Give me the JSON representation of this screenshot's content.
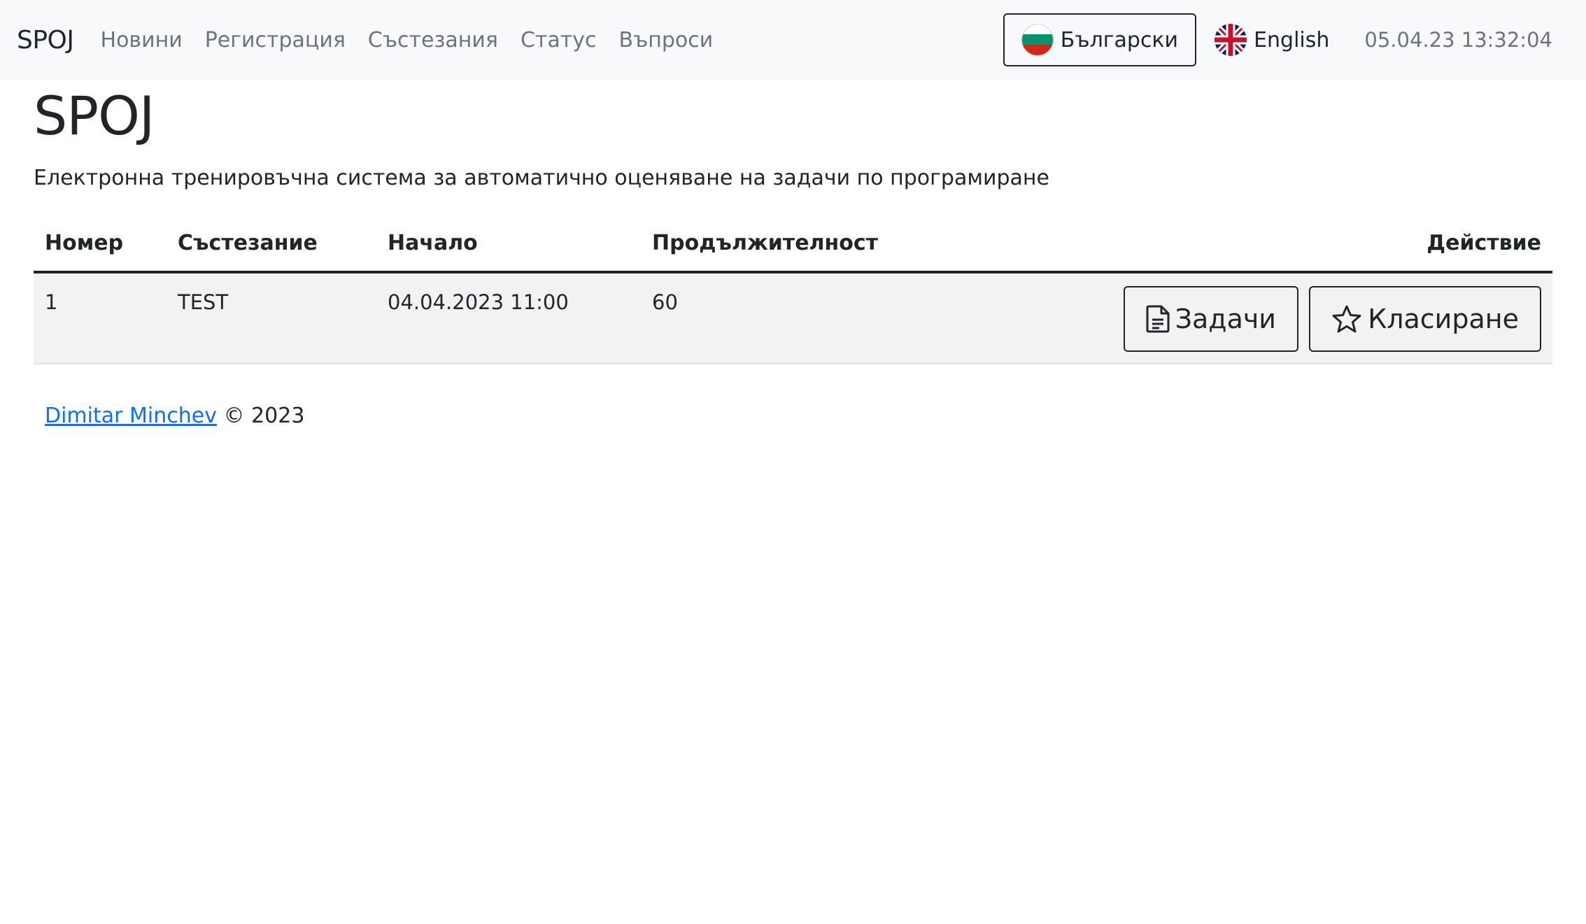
{
  "navbar": {
    "brand": "SPOJ",
    "links": [
      "Новини",
      "Регистрация",
      "Състезания",
      "Статус",
      "Въпроси"
    ],
    "lang_bg": "Български",
    "lang_en": "English",
    "datetime": "05.04.23 13:32:04"
  },
  "main": {
    "title": "SPOJ",
    "description": "Електронна тренировъчна система за автоматично оценяване на задачи по програмиране"
  },
  "table": {
    "headers": [
      "Номер",
      "Състезание",
      "Начало",
      "Продължителност",
      "Действие"
    ],
    "rows": [
      {
        "number": "1",
        "contest": "TEST",
        "start": "04.04.2023 11:00",
        "duration": "60"
      }
    ],
    "actions": {
      "tasks": "Задачи",
      "ranking": "Класиране"
    }
  },
  "footer": {
    "author": "Dimitar Minchev",
    "copyright": "© 2023"
  },
  "icons": {
    "flag_bg": "bulgaria-flag-icon",
    "flag_en": "uk-flag-icon",
    "tasks": "file-text-icon",
    "ranking": "star-icon"
  }
}
